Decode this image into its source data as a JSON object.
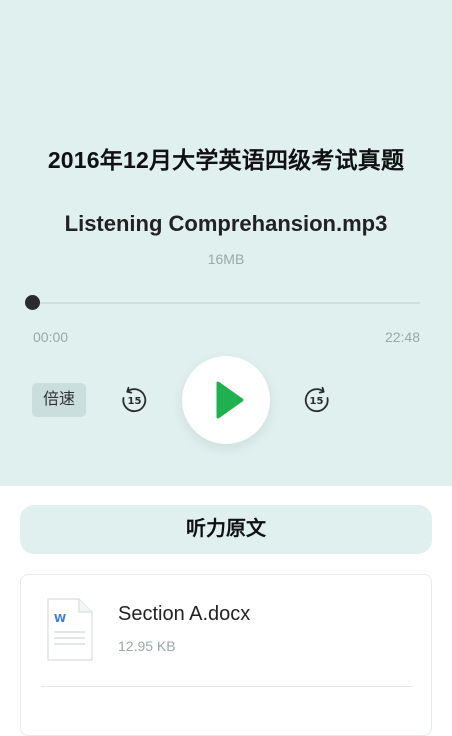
{
  "player": {
    "title": "2016年12月大学英语四级考试真题",
    "file_name": "Listening Comprehansion.mp3",
    "file_size": "16MB",
    "time_current": "00:00",
    "time_total": "22:48",
    "progress_fraction": 0,
    "speed_label": "倍速",
    "skip_seconds": "15"
  },
  "transcript": {
    "header": "听力原文",
    "files": [
      {
        "name": "Section A.docx",
        "size": "12.95 KB",
        "icon": "word-doc-icon"
      }
    ]
  },
  "colors": {
    "top_background": "#dff0ef",
    "play_green": "#1fb04f",
    "word_blue": "#3b7fd6"
  }
}
